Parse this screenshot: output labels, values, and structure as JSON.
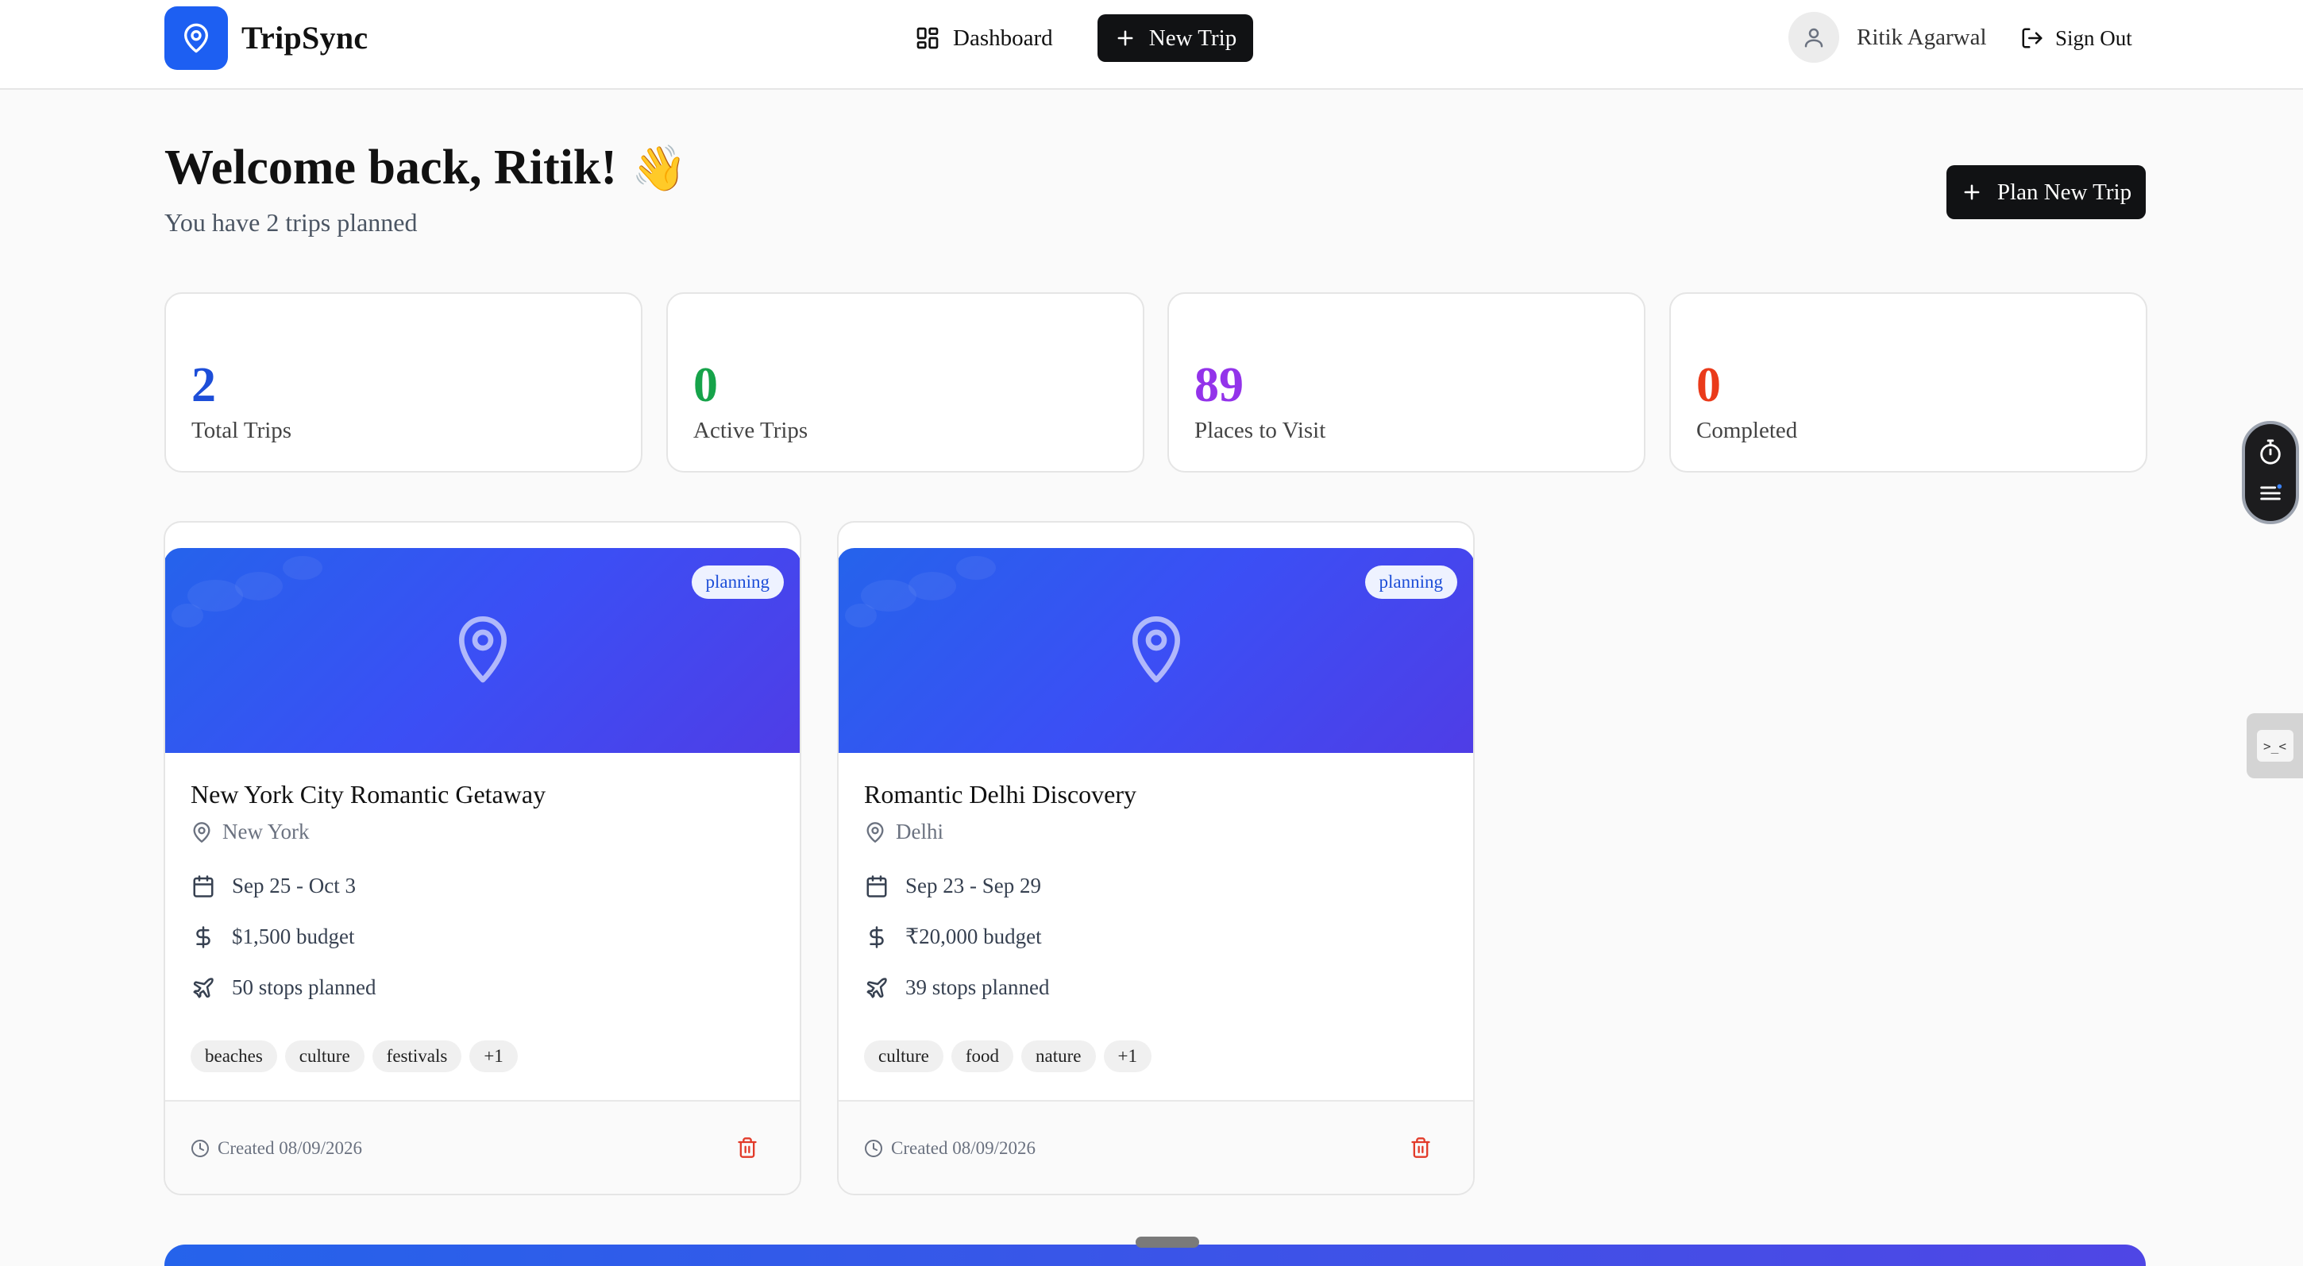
{
  "app": {
    "name": "TripSync",
    "logo_icon": "map-pin-icon",
    "brand_color": "#1d5ff2"
  },
  "nav": {
    "dashboard_label": "Dashboard",
    "new_trip_label": "New Trip"
  },
  "user": {
    "name": "Ritik Agarwal",
    "sign_out_label": "Sign Out"
  },
  "welcome": {
    "title": "Welcome back, Ritik!",
    "emoji": "👋",
    "subtitle": "You have 2 trips planned",
    "plan_button_label": "Plan New Trip"
  },
  "stats": [
    {
      "value": "2",
      "label": "Total Trips",
      "color": "#1d4ed8"
    },
    {
      "value": "0",
      "label": "Active Trips",
      "color": "#16a34a"
    },
    {
      "value": "89",
      "label": "Places to Visit",
      "color": "#9333ea"
    },
    {
      "value": "0",
      "label": "Completed",
      "color": "#ea3a1a"
    }
  ],
  "trips": [
    {
      "status": "planning",
      "title": "New York City Romantic Getaway",
      "location": "New York",
      "dates": "Sep 25 - Oct 3",
      "budget": "$1,500 budget",
      "stops": "50 stops planned",
      "tags": [
        "beaches",
        "culture",
        "festivals",
        "+1"
      ],
      "created": "Created 08/09/2026"
    },
    {
      "status": "planning",
      "title": "Romantic Delhi Discovery",
      "location": "Delhi",
      "dates": "Sep 23 - Sep 29",
      "budget": "₹20,000 budget",
      "stops": "39 stops planned",
      "tags": [
        "culture",
        "food",
        "nature",
        "+1"
      ],
      "created": "Created 08/09/2026"
    }
  ],
  "widgets": {
    "timer_icon": "stopwatch-icon",
    "menu_icon": "menu-icon",
    "tab_glyph": ">_<"
  }
}
